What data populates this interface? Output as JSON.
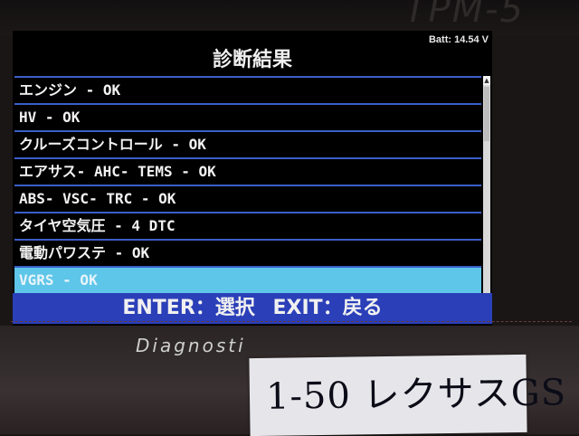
{
  "device": {
    "brand": "TPM-5",
    "caption": "Diagnosti"
  },
  "screen": {
    "battery": "Batt: 14.54 V",
    "title": "診断結果",
    "items": [
      {
        "label": "エンジン - OK",
        "selected": false
      },
      {
        "label": "HV - OK",
        "selected": false
      },
      {
        "label": "クルーズコントロール - OK",
        "selected": false
      },
      {
        "label": "エアサス- AHC- TEMS - OK",
        "selected": false
      },
      {
        "label": "ABS- VSC- TRC - OK",
        "selected": false
      },
      {
        "label": "タイヤ空気圧 - 4 DTC",
        "selected": false
      },
      {
        "label": "電動パワステ - OK",
        "selected": false
      },
      {
        "label": "VGRS - OK",
        "selected": true
      }
    ],
    "footer": {
      "enter": "ENTER：選択",
      "exit": "EXIT：戻る"
    }
  },
  "note": {
    "text": "1-50 レクサスGS"
  },
  "colors": {
    "row_border": "#3a5fc8",
    "selected_row": "#5ec6e8",
    "footer_bg": "#2a3fb8"
  }
}
